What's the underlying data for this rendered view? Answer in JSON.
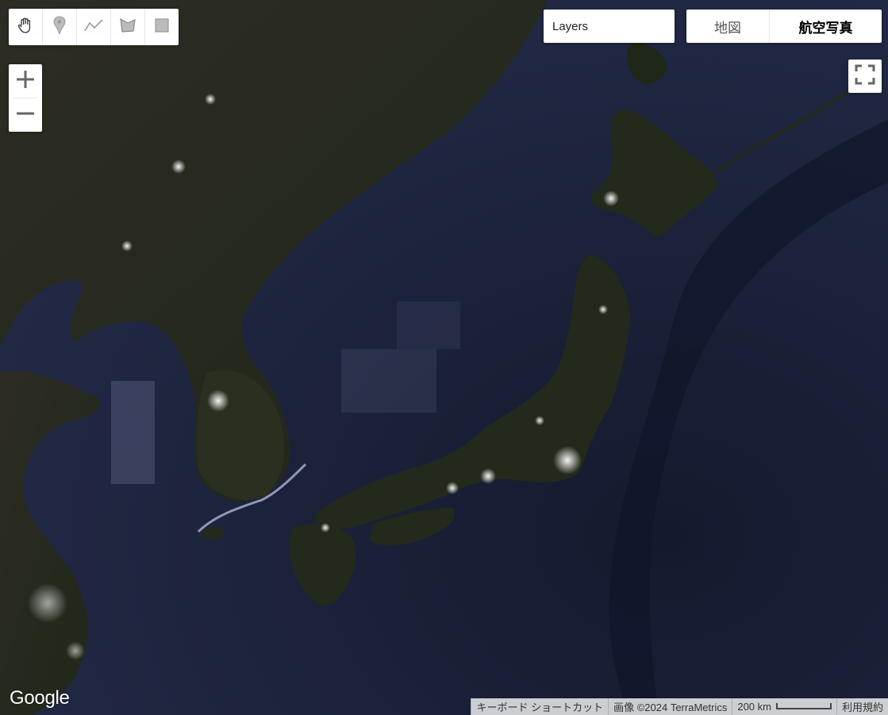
{
  "draw_tools": [
    {
      "icon": "hand-icon",
      "name": "pan"
    },
    {
      "icon": "marker-icon",
      "name": "marker"
    },
    {
      "icon": "polyline-icon",
      "name": "polyline"
    },
    {
      "icon": "polygon-icon",
      "name": "polygon"
    },
    {
      "icon": "rectangle-icon",
      "name": "rectangle"
    }
  ],
  "zoom": {
    "in_icon": "plus-icon",
    "out_icon": "minus-icon"
  },
  "layers": {
    "label": "Layers"
  },
  "map_type": {
    "map_label": "地図",
    "satellite_label": "航空写真",
    "selected": "satellite"
  },
  "fullscreen": {
    "icon": "fullscreen-icon"
  },
  "logo": {
    "text": "Google"
  },
  "attribution": {
    "shortcuts": "キーボード ショートカット",
    "imagery": "画像 ©2024 TerraMetrics",
    "scale": "200 km",
    "terms": "利用規約"
  },
  "colors": {
    "ocean": "#1c2238",
    "land": "#252a1c",
    "lights": "#f4f1d8"
  }
}
